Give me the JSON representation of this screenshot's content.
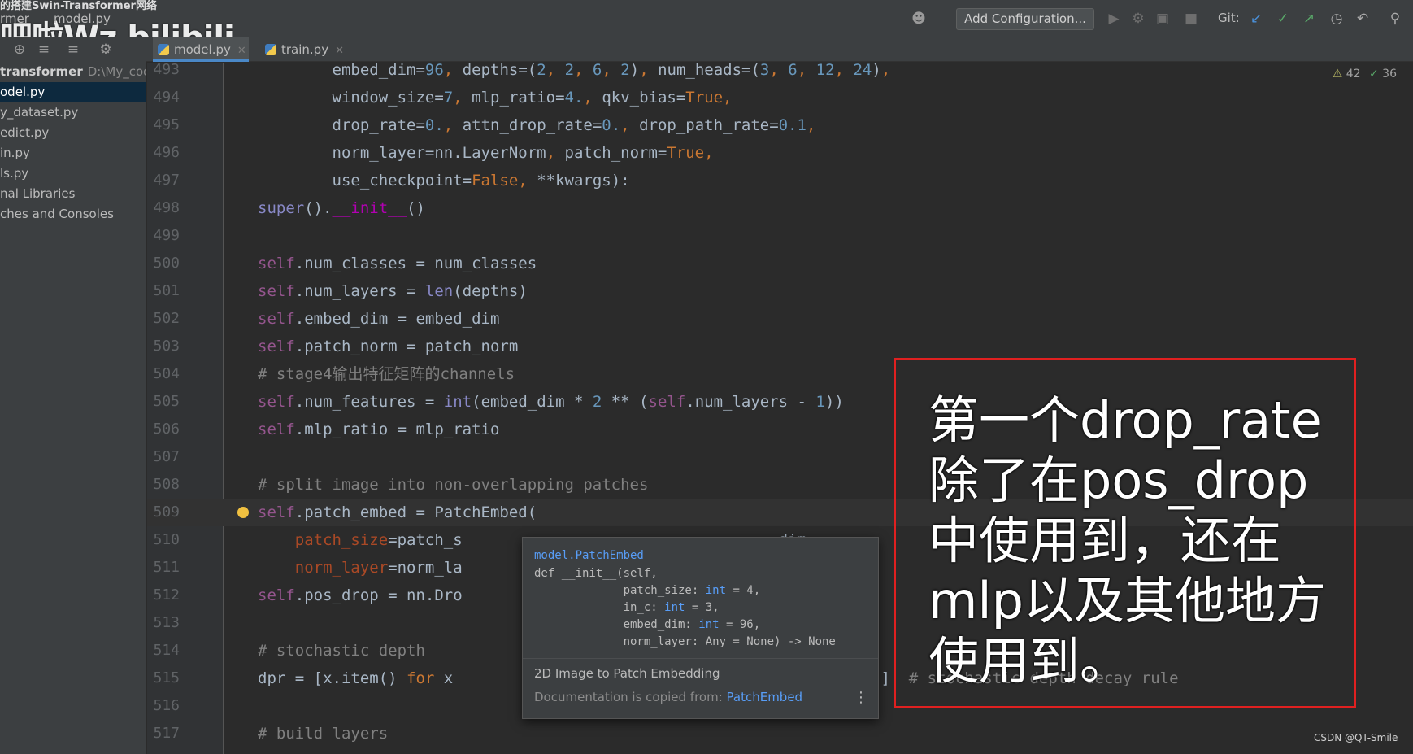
{
  "watermark": {
    "top_text": "的搭建Swin-Transformer网络",
    "main_text": "吧啦Wz bilibili"
  },
  "breadcrumb": {
    "project": "rmer",
    "file": "model.py"
  },
  "toolbar": {
    "add_configuration": "Add Configuration...",
    "git_label": "Git:"
  },
  "tabs": [
    {
      "label": "model.py",
      "active": true
    },
    {
      "label": "train.py",
      "active": false
    }
  ],
  "sidebar": {
    "root_name": "transformer",
    "root_path": "D:\\My_code",
    "items": [
      {
        "label": "odel.py",
        "selected": true
      },
      {
        "label": "y_dataset.py",
        "selected": false
      },
      {
        "label": "edict.py",
        "selected": false
      },
      {
        "label": "in.py",
        "selected": false
      },
      {
        "label": "ls.py",
        "selected": false
      },
      {
        "label": "nal Libraries",
        "selected": false
      },
      {
        "label": "ches and Consoles",
        "selected": false
      }
    ]
  },
  "inspections": {
    "warnings": "42",
    "weak_warnings": "36"
  },
  "code_lines": [
    {
      "n": "493",
      "html": "        embed_dim=<span class='num'>96</span><span class='kw'>,</span> depths=(<span class='num'>2</span><span class='kw'>,</span> <span class='num'>2</span><span class='kw'>,</span> <span class='num'>6</span><span class='kw'>,</span> <span class='num'>2</span>)<span class='kw'>,</span> num_heads=(<span class='num'>3</span><span class='kw'>,</span> <span class='num'>6</span><span class='kw'>,</span> <span class='num'>12</span><span class='kw'>,</span> <span class='num'>24</span>)<span class='kw'>,</span>"
    },
    {
      "n": "494",
      "html": "        window_size=<span class='num'>7</span><span class='kw'>,</span> mlp_ratio=<span class='num'>4.</span><span class='kw'>,</span> qkv_bias=<span class='kw'>True</span><span class='kw'>,</span>"
    },
    {
      "n": "495",
      "html": "        drop_rate=<span class='num'>0.</span><span class='kw'>,</span> attn_drop_rate=<span class='num'>0.</span><span class='kw'>,</span> drop_path_rate=<span class='num'>0.1</span><span class='kw'>,</span>"
    },
    {
      "n": "496",
      "html": "        norm_layer=nn.LayerNorm<span class='kw'>,</span> patch_norm=<span class='kw'>True</span><span class='kw'>,</span>"
    },
    {
      "n": "497",
      "html": "        use_checkpoint=<span class='kw'>False</span><span class='kw'>,</span> **kwargs):"
    },
    {
      "n": "498",
      "html": "<span class='bi'>super</span>().<span class='fn'>__init__</span>()"
    },
    {
      "n": "499",
      "html": ""
    },
    {
      "n": "500",
      "html": "<span class='slf'>self</span>.num_classes = num_classes"
    },
    {
      "n": "501",
      "html": "<span class='slf'>self</span>.num_layers = <span class='bi'>len</span>(depths)"
    },
    {
      "n": "502",
      "html": "<span class='slf'>self</span>.embed_dim = embed_dim"
    },
    {
      "n": "503",
      "html": "<span class='slf'>self</span>.patch_norm = patch_norm"
    },
    {
      "n": "504",
      "html": "<span class='cm'># stage4输出特征矩阵的channels</span>"
    },
    {
      "n": "505",
      "html": "<span class='slf'>self</span>.num_features = <span class='bi'>int</span>(embed_dim * <span class='num'>2</span> ** (<span class='slf'>self</span>.num_layers - <span class='num'>1</span>))"
    },
    {
      "n": "506",
      "html": "<span class='slf'>self</span>.mlp_ratio = mlp_ratio"
    },
    {
      "n": "507",
      "html": ""
    },
    {
      "n": "508",
      "html": "<span class='cm'># split image into non-overlapping patches</span>"
    },
    {
      "n": "509",
      "html": "<span class='slf'>self</span>.patch_embed = PatchEmbed("
    },
    {
      "n": "510",
      "html": "    <span class='par'>patch_size</span>=patch_s                                  dim<span class='kw'>,</span>"
    },
    {
      "n": "511",
      "html": "    <span class='par'>norm_layer</span>=norm_la"
    },
    {
      "n": "512",
      "html": "<span class='slf'>self</span>.pos_drop = nn.Dro"
    },
    {
      "n": "513",
      "html": ""
    },
    {
      "n": "514",
      "html": "<span class='cm'># stochastic depth</span>"
    },
    {
      "n": "515",
      "html": "dpr = [x.item() <span class='kw'>for</span> x                                  <span class='bi'>sum</span>(depths))]  <span class='cm'># stochastic depth decay rule</span>"
    },
    {
      "n": "516",
      "html": ""
    },
    {
      "n": "517",
      "html": "<span class='cm'># build layers</span>"
    }
  ],
  "popup": {
    "qualified_name": "model.PatchEmbed",
    "signature_lines": [
      "def __init__(self,",
      "             patch_size: int = 4,",
      "             in_c: int = 3,",
      "             embed_dim: int = 96,",
      "             norm_layer: Any = None) -> None"
    ],
    "description": "2D Image to Patch Embedding",
    "source_prefix": "Documentation is copied from: ",
    "source_link": "PatchEmbed"
  },
  "annotation": {
    "text": "第一个drop_rate除了在pos_drop中使用到，还在mlp以及其他地方使用到。"
  },
  "credit": "CSDN @QT-Smile"
}
